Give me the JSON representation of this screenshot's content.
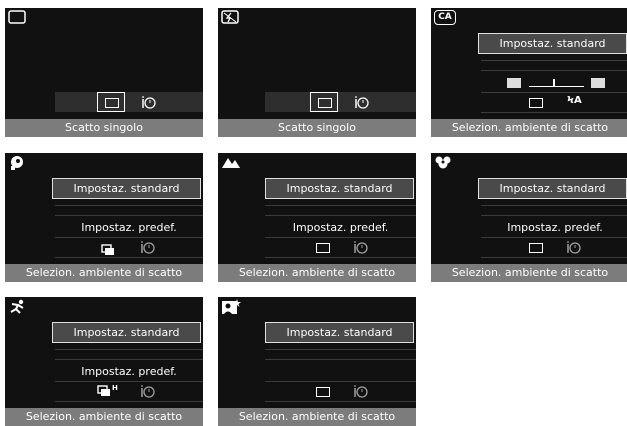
{
  "screens": [
    {
      "id": "full-auto",
      "mode": "full-auto-icon",
      "footer": "Scatto singolo"
    },
    {
      "id": "flash-off",
      "mode": "flash-off-icon",
      "footer": "Scatto singolo"
    },
    {
      "id": "creative-auto",
      "mode_label": "CA",
      "box": "Impostaz. standard",
      "footer": "Selezion. ambiente di scatto"
    },
    {
      "id": "portrait",
      "mode": "portrait-icon",
      "box": "Impostaz. standard",
      "sub": "Impostaz. predef.",
      "footer": "Selezion. ambiente di scatto"
    },
    {
      "id": "landscape",
      "mode": "landscape-icon",
      "box": "Impostaz. standard",
      "sub": "Impostaz. predef.",
      "footer": "Selezion. ambiente di scatto"
    },
    {
      "id": "closeup",
      "mode": "closeup-icon",
      "box": "Impostaz. standard",
      "sub": "Impostaz. predef.",
      "footer": "Selezion. ambiente di scatto"
    },
    {
      "id": "sports",
      "mode": "sports-icon",
      "box": "Impostaz. standard",
      "sub": "Impostaz. predef.",
      "footer": "Selezion. ambiente di scatto"
    },
    {
      "id": "night-portrait",
      "mode": "night-portrait-icon",
      "box": "Impostaz. standard",
      "footer": "Selezion. ambiente di scatto"
    }
  ],
  "glyphs": {
    "flash_auto": "ϞA",
    "continuous_h": "H"
  }
}
